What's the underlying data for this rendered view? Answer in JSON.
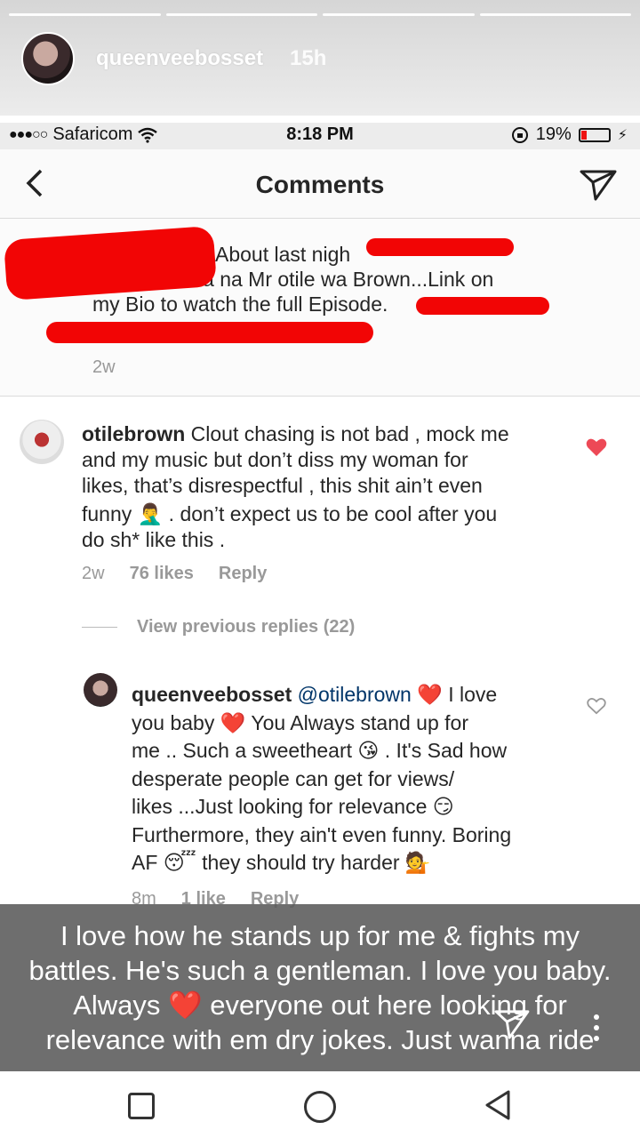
{
  "story": {
    "username": "queenveebosset",
    "time": "15h",
    "segments": 4
  },
  "statusbar": {
    "signal": "●●●○○",
    "carrier": "Safaricom",
    "time": "8:18 PM",
    "battery": "19%",
    "battery_level": 0.19
  },
  "nav": {
    "title": "Comments",
    "back_icon": "chevron-left-icon",
    "send_icon": "paper-plane-icon"
  },
  "caption": {
    "lines": [
      "About last nigh",
      "Show Tulikua na Mr otile wa Brown...Link on",
      "my Bio to watch the full Episode."
    ],
    "time": "2w"
  },
  "comments": [
    {
      "username": "otilebrown",
      "text_1": " Clout chasing is not bad , mock me",
      "text_2": "and my music but don’t diss my woman for",
      "text_3": "likes, that’s disrespectful , this shit ain’t even",
      "text_4": "funny 🤦‍♂️ . don’t expect us to be cool after you",
      "text_5": "do sh* like this .",
      "time": "2w",
      "likes": "76 likes",
      "reply": "Reply",
      "liked": true
    }
  ],
  "view_previous": "View previous replies (22)",
  "reply": {
    "username": "queenveebosset",
    "mention": "@otilebrown",
    "line_1_rest": " ❤️ I love",
    "line_2": "you baby ❤️  You Always stand up for",
    "line_3": "me .. Such a sweetheart 😘 . It's Sad how",
    "line_4": "desperate people can get for views/",
    "line_5": "likes ...Just looking for relevance 😏",
    "line_6": "Furthermore, they ain't even funny. Boring",
    "line_7": "AF 😴  they should try harder 💁",
    "time": "8m",
    "likes": "1 like",
    "reply_label": "Reply",
    "liked": false
  },
  "overlay": {
    "line_1": "I love how he stands up for me & fights my",
    "line_2": "battles. He's such a gentleman. I love you baby.",
    "line_3": "Always ❤️  everyone out here looking for",
    "line_4": "relevance with em dry jokes. Just wanna ride"
  },
  "colors": {
    "like_red": "#ed4956",
    "redaction": "#f20505",
    "meta_gray": "#999999"
  }
}
